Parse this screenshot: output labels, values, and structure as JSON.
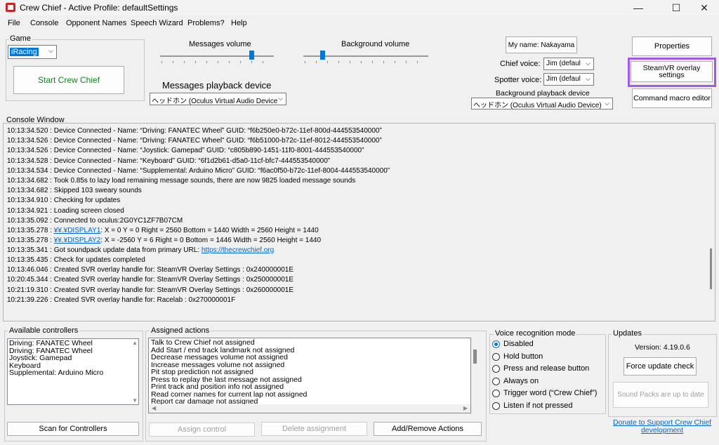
{
  "window": {
    "title": "Crew Chief - Active Profile: defaultSettings",
    "minimize": "—",
    "maximize": "☐",
    "close": "✕"
  },
  "menu": [
    "File",
    "Console",
    "Opponent Names",
    "Speech Wizard",
    "Problems?",
    "Help"
  ],
  "game": {
    "label": "Game",
    "selected": "iRacing"
  },
  "start_button": "Start Crew Chief",
  "messages_volume": {
    "label": "Messages volume",
    "level": 0.8
  },
  "background_volume": {
    "label": "Background volume",
    "level": 0.15
  },
  "playback_device": {
    "label": "Messages playback device",
    "selected": "ヘッドホン (Oculus Virtual Audio Device"
  },
  "my_name_button": "My name: Nakayama",
  "chief_voice": {
    "label": "Chief voice:",
    "selected": "Jim (defaul"
  },
  "spotter_voice": {
    "label": "Spotter voice:",
    "selected": "Jim (defaul"
  },
  "background_playback": {
    "label": "Background playback device",
    "selected": "ヘッドホン (Oculus Virtual Audio Device)"
  },
  "properties_button": "Properties",
  "steamvr_button": "SteamVR overlay settings",
  "command_macro_button": "Command macro editor",
  "console": {
    "label": "Console Window",
    "lines": [
      "10:13:34.520 : Device Connected -   Name: “Driving: FANATEC Wheel”    GUID: “f6b250e0-b72c-11ef-800d-444553540000”",
      "10:13:34.526 : Device Connected -   Name: “Driving: FANATEC Wheel”    GUID: “f6b51000-b72c-11ef-8012-444553540000”",
      "10:13:34.526 : Device Connected -   Name: “Joystick: Gamepad”    GUID: “c805b890-1451-11f0-8001-444553540000”",
      "10:13:34.528 : Device Connected -   Name: “Keyboard”    GUID: “6f1d2b61-d5a0-11cf-bfc7-444553540000”",
      "10:13:34.534 : Device Connected -   Name: “Supplemental: Arduino Micro”    GUID: “f6ac0f50-b72c-11ef-8004-444553540000”",
      "10:13:34.682 : Took 0.85s to lazy load remaining message sounds, there are now 9825 loaded message sounds",
      "10:13:34.682 : Skipped 103 sweary sounds",
      "10:13:34.910 : Checking for updates",
      "10:13:34.921 : Loading screen closed",
      "10:13:35.092 : Connected to oculus:2G0YC1ZF7B07CM"
    ],
    "display1_prefix": "10:13:35.278 : ",
    "display1_link": "¥¥.¥DISPLAY1",
    "display1_rest": ": X = 0   Y = 0   Right = 2560   Bottom = 1440 Width = 2560 Height = 1440",
    "display2_prefix": "10:13:35.278 : ",
    "display2_link": "¥¥.¥DISPLAY2",
    "display2_rest": ": X = -2560   Y = 6   Right = 0   Bottom = 1446 Width = 2560 Height = 1440",
    "soundpack_prefix": "10:13:35.341 : Got soundpack update data from primary URL: ",
    "soundpack_link": "https://thecrewchief.org",
    "lines2": [
      "10:13:35.435 : Check for updates completed",
      "10:13:46.046 : Created SVR overlay handle for: SteamVR Overlay Settings : 0x240000001E",
      "10:20:45.344 : Created SVR overlay handle for: SteamVR Overlay Settings : 0x250000001E",
      "10:21:19.310 : Created SVR overlay handle for: SteamVR Overlay Settings : 0x260000001E",
      "10:21:39.226 : Created SVR overlay handle for: Racelab : 0x270000001F"
    ]
  },
  "controllers": {
    "label": "Available controllers",
    "items": [
      "Driving: FANATEC Wheel",
      "Driving: FANATEC Wheel",
      "Joystick: Gamepad",
      "Keyboard",
      "Supplemental: Arduino Micro"
    ],
    "scan_button": "Scan for Controllers"
  },
  "actions": {
    "label": "Assigned actions",
    "items": [
      "Talk to Crew Chief not assigned",
      "Add Start / end track landmark not assigned",
      "Decrease messages volume not assigned",
      "Increase messages volume not assigned",
      "Pit stop prediction not assigned",
      "Press to replay the last message not assigned",
      "Print track and position info not assigned",
      "Read corner names for current lap not assigned",
      "Report car damage not assigned"
    ],
    "assign_button": "Assign control",
    "delete_button": "Delete assignment",
    "add_remove_button": "Add/Remove Actions"
  },
  "voice": {
    "label": "Voice recognition mode",
    "options": [
      "Disabled",
      "Hold button",
      "Press and release button",
      "Always on",
      "Trigger word (“Crew Chief”)",
      "Listen if not pressed"
    ],
    "selected_index": 0
  },
  "updates": {
    "label": "Updates",
    "version": "Version: 4.19.0.6",
    "force_button": "Force update check",
    "sound_packs_button": "Sound Packs are up to date",
    "donate_link": "Donate to Support Crew Chief development"
  },
  "colors": {
    "accent": "#0078d7",
    "highlight": "#a259e6",
    "start_text": "#0a8a1a",
    "link": "#0066cc"
  }
}
